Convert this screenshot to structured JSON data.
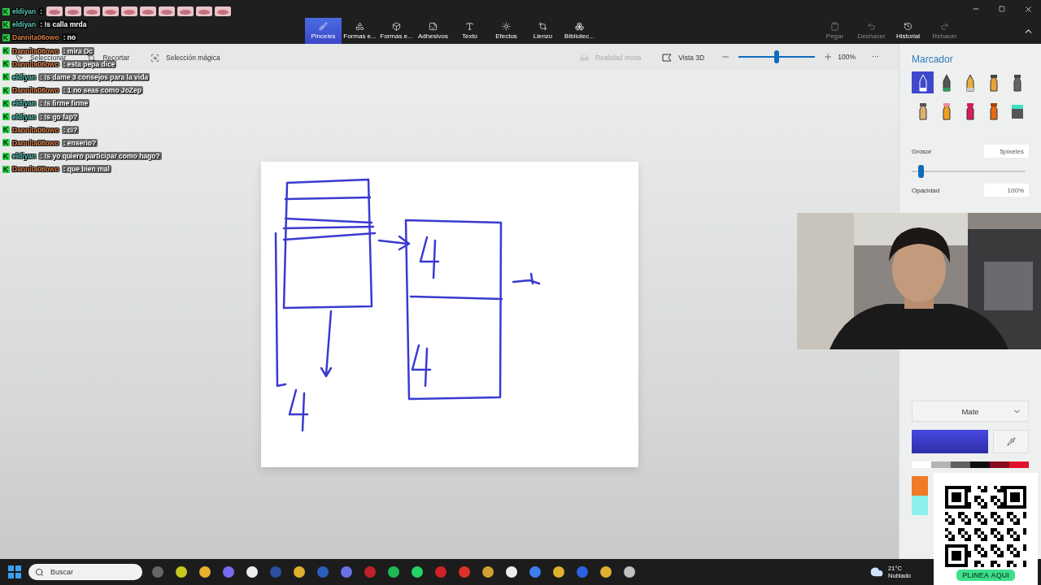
{
  "ribbon": {
    "tabs": [
      {
        "label": "Pinceles",
        "selected": true
      },
      {
        "label": "Formas e...",
        "selected": false
      },
      {
        "label": "Formas e...",
        "selected": false
      },
      {
        "label": "Adhesivos",
        "selected": false
      },
      {
        "label": "Texto",
        "selected": false
      },
      {
        "label": "Efectos",
        "selected": false
      },
      {
        "label": "Lienzo",
        "selected": false
      },
      {
        "label": "Bibliotec...",
        "selected": false
      }
    ],
    "actions": [
      {
        "label": "Pegar",
        "disabled": true
      },
      {
        "label": "Deshacer",
        "disabled": true
      },
      {
        "label": "Historial",
        "disabled": false
      },
      {
        "label": "Rehacer",
        "disabled": true
      }
    ]
  },
  "toolbar": {
    "tools": [
      "Seleccionar",
      "Recortar",
      "Selección mágica"
    ],
    "mixed_reality": {
      "label": "Realidad mixta",
      "disabled": true
    },
    "view3d": "Vista 3D",
    "zoom": {
      "level": 0.5,
      "reading": "100%"
    },
    "more": "⋯"
  },
  "panel": {
    "title": "Marcador",
    "brushes": [
      {
        "selected": true
      },
      {
        "selected": false
      },
      {
        "selected": false
      },
      {
        "selected": false
      },
      {
        "selected": false
      },
      {
        "selected": false
      },
      {
        "selected": false
      },
      {
        "selected": false
      },
      {
        "selected": false
      },
      {
        "selected": false
      }
    ],
    "thickness": {
      "label": "Grosor",
      "value": "5píxeles",
      "level": 0.06
    },
    "opacity": {
      "label": "Opacidad",
      "value": "100%"
    },
    "finish": "Mate",
    "palette": [
      {
        "color": "#ffffff"
      },
      {
        "color": "#b4b4b4"
      },
      {
        "color": "#5f5f5f"
      },
      {
        "color": "#0e0e0e"
      },
      {
        "color": "#8a0a1f"
      },
      {
        "color": "#e3102c"
      }
    ],
    "palette_column": [
      {
        "color": "#f07a26"
      },
      {
        "color": "#8cf0ec"
      }
    ]
  },
  "chat": [
    {
      "user": "eldiyan",
      "color": "#5cc9b8",
      "kind": "emotes",
      "text": ":"
    },
    {
      "user": "eldiyan",
      "color": "#5cc9b8",
      "kind": "text",
      "text": ": !s calla mrda"
    },
    {
      "user": "Dannita06owo",
      "color": "#d9804a",
      "kind": "text",
      "text": ": no"
    },
    {
      "user": "Dannita06owo",
      "color": "#d9804a",
      "kind": "text",
      "text": ": mira Dc"
    },
    {
      "user": "Dannita06owo",
      "color": "#d9804a",
      "kind": "text",
      "text": ": esta pepa dice"
    },
    {
      "user": "eldiyan",
      "color": "#5cc9b8",
      "kind": "text",
      "text": ": !s dame 3 consejos para la vida"
    },
    {
      "user": "Dannita06owo",
      "color": "#d9804a",
      "kind": "text",
      "text": ": 1 no seas como JoZep"
    },
    {
      "user": "eldiyan",
      "color": "#5cc9b8",
      "kind": "text",
      "text": ": !s firme firme"
    },
    {
      "user": "eldiyan",
      "color": "#5cc9b8",
      "kind": "text",
      "text": ": !s go fap?"
    },
    {
      "user": "Dannita06owo",
      "color": "#d9804a",
      "kind": "text",
      "text": ": ci?"
    },
    {
      "user": "Dannita06owo",
      "color": "#d9804a",
      "kind": "text",
      "text": ": enserio?"
    },
    {
      "user": "eldiyan",
      "color": "#5cc9b8",
      "kind": "text",
      "text": ": !s yo quiero participar como hago?"
    },
    {
      "user": "Dannita06owo",
      "color": "#d9804a",
      "kind": "text",
      "text": ": que bien mal"
    }
  ],
  "qr": {
    "label": "PLINEA AQUI"
  },
  "taskbar": {
    "search": {
      "placeholder": "Buscar"
    },
    "weather": {
      "temperature": "21°C",
      "condition": "Nublado"
    }
  }
}
